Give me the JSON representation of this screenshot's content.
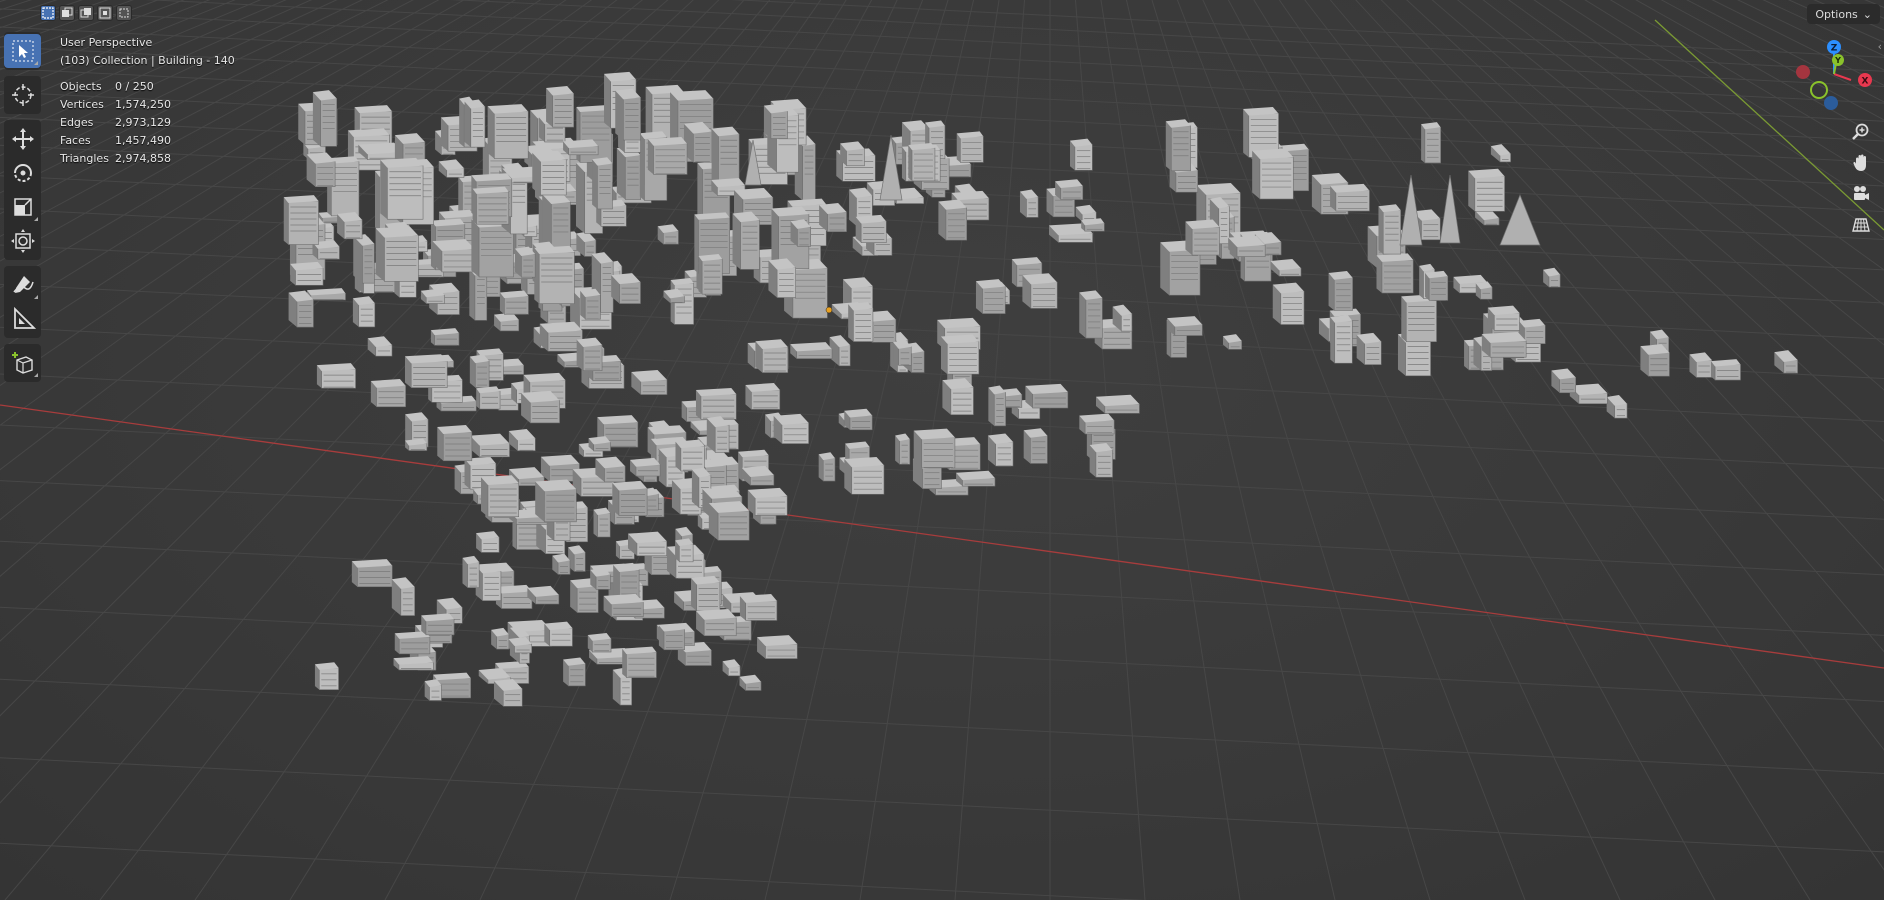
{
  "header": {
    "selection_modes": [
      "select-box-mode",
      "select-extend-mode",
      "select-subtract-mode",
      "select-invert-mode",
      "select-intersect-mode"
    ],
    "options_label": "Options"
  },
  "toolbar": {
    "tools": [
      "select-box-tool",
      "cursor-tool",
      "move-tool",
      "rotate-tool",
      "scale-tool",
      "transform-tool",
      "annotate-tool",
      "measure-tool",
      "add-cube-tool"
    ],
    "active_tool": "select-box-tool"
  },
  "viewport": {
    "view_name": "User Perspective",
    "collection_info": "(103) Collection | Building - 140",
    "stats": [
      {
        "label": "Objects",
        "value": "0 / 250"
      },
      {
        "label": "Vertices",
        "value": "1,574,250"
      },
      {
        "label": "Edges",
        "value": "2,973,129"
      },
      {
        "label": "Faces",
        "value": "1,457,490"
      },
      {
        "label": "Triangles",
        "value": "2,974,858"
      }
    ]
  },
  "gizmo": {
    "axes": {
      "x": "X",
      "y": "Y",
      "z": "Z"
    },
    "colors": {
      "x": "#e8384f",
      "y": "#8ac22b",
      "z": "#2c8fff"
    }
  },
  "navigation": [
    "zoom-icon",
    "pan-hand-icon",
    "camera-view-icon",
    "ortho-grid-icon"
  ],
  "colors": {
    "accent": "#4772b3",
    "x_axis_line": "#b34040",
    "y_axis_line": "#7fa235",
    "grid": "#474747",
    "building": "#a9a9a9"
  }
}
